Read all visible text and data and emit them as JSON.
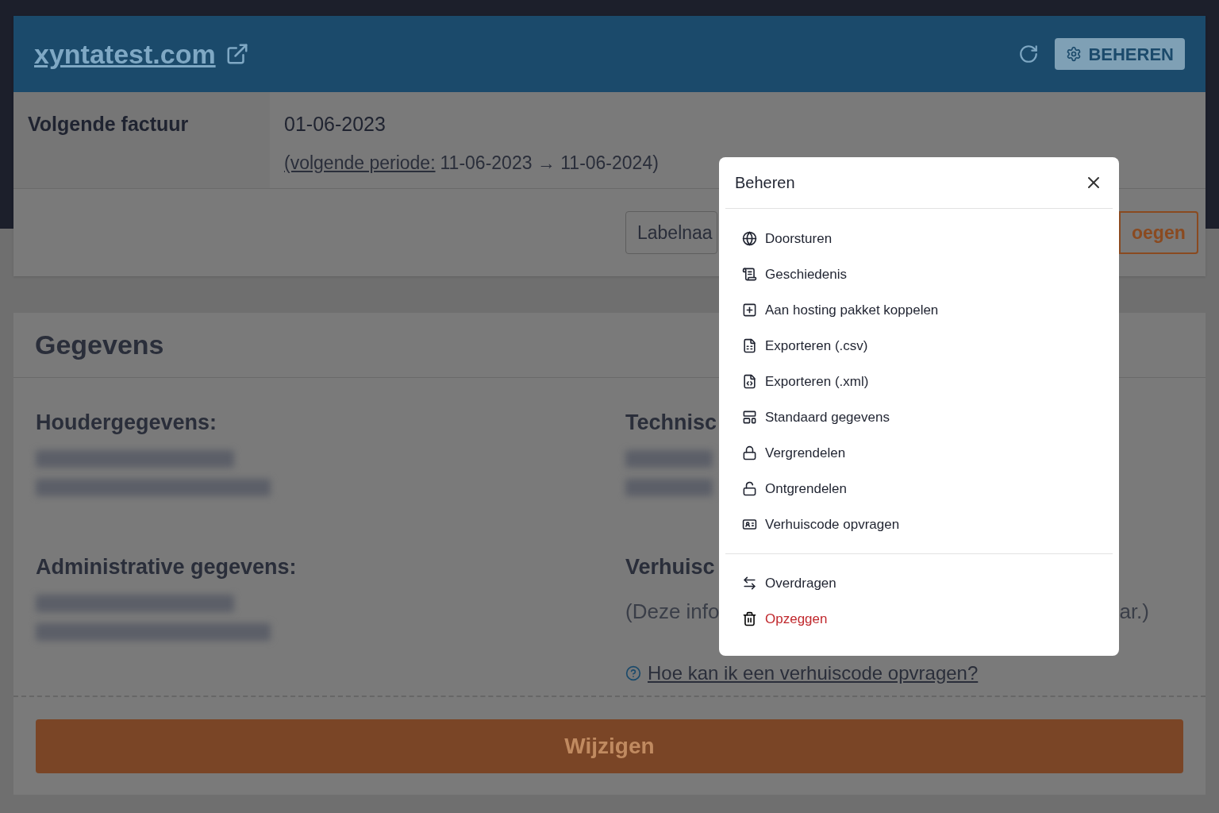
{
  "domain_card": {
    "domain": "xyntatest.com",
    "invoice": {
      "label": "Volgende factuur",
      "date": "01-06-2023",
      "period_link": "(volgende periode:",
      "period": "11-06-2023 → 11-06-2024)"
    },
    "manage_button": "BEHEREN",
    "label_field": {
      "placeholder": "Labelnaa"
    },
    "add_button": "oegen"
  },
  "details": {
    "title": "Gegevens",
    "left": [
      {
        "heading": "Houdergegevens:"
      },
      {
        "heading": "Administrative gegevens:"
      }
    ],
    "right_headings": [
      "Technisc",
      "Verhuisc"
    ],
    "note_start": "(Deze info",
    "note_end": "ar.)",
    "help_link": "Hoe kan ik een verhuiscode opvragen?",
    "edit_button": "Wijzigen"
  },
  "modal": {
    "title": "Beheren",
    "groups": [
      [
        {
          "label": "Doorsturen",
          "kind": "normal"
        },
        {
          "label": "Geschiedenis",
          "kind": "normal"
        },
        {
          "label": "Aan hosting pakket koppelen",
          "kind": "normal"
        },
        {
          "label": "Exporteren (.csv)",
          "kind": "normal"
        },
        {
          "label": "Exporteren (.xml)",
          "kind": "normal"
        },
        {
          "label": "Standaard gegevens",
          "kind": "normal"
        },
        {
          "label": "Vergrendelen",
          "kind": "normal"
        },
        {
          "label": "Ontgrendelen",
          "kind": "normal"
        },
        {
          "label": "Verhuiscode opvragen",
          "kind": "normal"
        }
      ],
      [
        {
          "label": "Overdragen",
          "kind": "normal"
        },
        {
          "label": "Opzeggen",
          "kind": "danger"
        }
      ]
    ]
  }
}
